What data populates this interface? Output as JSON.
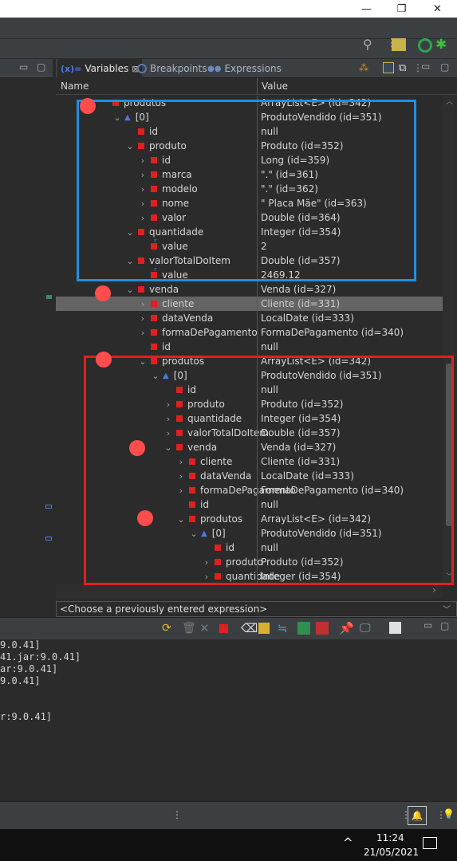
{
  "window": {
    "minimize": "—",
    "restore": "❐",
    "close": "✕"
  },
  "tabs": [
    {
      "label": "Variables",
      "icon": "variables-icon",
      "close": "⊠"
    },
    {
      "label": "Breakpoints",
      "icon": "breakpoints-icon"
    },
    {
      "label": "Expressions",
      "icon": "expressions-icon"
    }
  ],
  "columns": {
    "name": "Name",
    "value": "Value"
  },
  "rows": [
    {
      "indent": 0,
      "twisty": "",
      "icon": "arraylist",
      "name": "produtos",
      "value": "ArrayList<E>  (id=342)"
    },
    {
      "indent": 1,
      "twisty": "v",
      "icon": "element",
      "name": "[0]",
      "value": "ProdutoVendido  (id=351)"
    },
    {
      "indent": 2,
      "twisty": "",
      "icon": "field",
      "name": "id",
      "value": "null"
    },
    {
      "indent": 2,
      "twisty": "v",
      "icon": "field",
      "name": "produto",
      "value": "Produto  (id=352)"
    },
    {
      "indent": 3,
      "twisty": ">",
      "icon": "field",
      "name": "id",
      "value": "Long  (id=359)"
    },
    {
      "indent": 3,
      "twisty": ">",
      "icon": "field",
      "name": "marca",
      "value": "\".\" (id=361)"
    },
    {
      "indent": 3,
      "twisty": ">",
      "icon": "field",
      "name": "modelo",
      "value": "\".\" (id=362)"
    },
    {
      "indent": 3,
      "twisty": ">",
      "icon": "field",
      "name": "nome",
      "value": "\" Placa Mãe\" (id=363)"
    },
    {
      "indent": 3,
      "twisty": ">",
      "icon": "field",
      "name": "valor",
      "value": "Double  (id=364)"
    },
    {
      "indent": 2,
      "twisty": "v",
      "icon": "field",
      "name": "quantidade",
      "value": "Integer  (id=354)"
    },
    {
      "indent": 3,
      "twisty": "",
      "icon": "final",
      "name": "value",
      "value": "2"
    },
    {
      "indent": 2,
      "twisty": "v",
      "icon": "field",
      "name": "valorTotalDoItem",
      "value": "Double  (id=357)"
    },
    {
      "indent": 3,
      "twisty": "",
      "icon": "final",
      "name": "value",
      "value": "2469.12"
    },
    {
      "indent": 2,
      "twisty": "v",
      "icon": "field",
      "name": "venda",
      "value": "Venda  (id=327)"
    },
    {
      "indent": 3,
      "twisty": ">",
      "icon": "field",
      "name": "cliente",
      "value": "Cliente  (id=331)",
      "selected": true
    },
    {
      "indent": 3,
      "twisty": ">",
      "icon": "field",
      "name": "dataVenda",
      "value": "LocalDate  (id=333)"
    },
    {
      "indent": 3,
      "twisty": ">",
      "icon": "field",
      "name": "formaDePagamento",
      "value": "FormaDePagamento  (id=340)"
    },
    {
      "indent": 3,
      "twisty": "",
      "icon": "field",
      "name": "id",
      "value": "null"
    },
    {
      "indent": 3,
      "twisty": "v",
      "icon": "arraylist",
      "name": "produtos",
      "value": "ArrayList<E>  (id=342)"
    },
    {
      "indent": 4,
      "twisty": "v",
      "icon": "element",
      "name": "[0]",
      "value": "ProdutoVendido  (id=351)"
    },
    {
      "indent": 5,
      "twisty": "",
      "icon": "field",
      "name": "id",
      "value": "null"
    },
    {
      "indent": 5,
      "twisty": ">",
      "icon": "field",
      "name": "produto",
      "value": "Produto  (id=352)"
    },
    {
      "indent": 5,
      "twisty": ">",
      "icon": "field",
      "name": "quantidade",
      "value": "Integer  (id=354)"
    },
    {
      "indent": 5,
      "twisty": ">",
      "icon": "field",
      "name": "valorTotalDoItem",
      "value": "Double  (id=357)"
    },
    {
      "indent": 5,
      "twisty": "v",
      "icon": "field",
      "name": "venda",
      "value": "Venda  (id=327)"
    },
    {
      "indent": 6,
      "twisty": ">",
      "icon": "field",
      "name": "cliente",
      "value": "Cliente  (id=331)"
    },
    {
      "indent": 6,
      "twisty": ">",
      "icon": "field",
      "name": "dataVenda",
      "value": "LocalDate  (id=333)"
    },
    {
      "indent": 6,
      "twisty": ">",
      "icon": "field",
      "name": "formaDePagamento",
      "value": "FormaDePagamento  (id=340)"
    },
    {
      "indent": 6,
      "twisty": "",
      "icon": "field",
      "name": "id",
      "value": "null"
    },
    {
      "indent": 6,
      "twisty": "v",
      "icon": "arraylist",
      "name": "produtos",
      "value": "ArrayList<E>  (id=342)"
    },
    {
      "indent": 7,
      "twisty": "v",
      "icon": "element",
      "name": "[0]",
      "value": "ProdutoVendido  (id=351)"
    },
    {
      "indent": 8,
      "twisty": "",
      "icon": "field",
      "name": "id",
      "value": "null"
    },
    {
      "indent": 8,
      "twisty": ">",
      "icon": "field",
      "name": "produto",
      "value": "Produto  (id=352)"
    },
    {
      "indent": 8,
      "twisty": ">",
      "icon": "field",
      "name": "quantidade",
      "value": "Integer  (id=354)"
    }
  ],
  "expression": {
    "placeholder": "<Choose a previously entered expression>"
  },
  "console_lines": [
    "9.0.41]",
    "41.jar:9.0.41]",
    "ar:9.0.41]",
    "9.0.41]",
    "",
    "",
    "r:9.0.41]"
  ],
  "taskbar": {
    "time": "11:24",
    "date": "21/05/2021",
    "chevron": "^"
  },
  "colors": {
    "highlight_blue": "#1f8fe0",
    "highlight_red": "#e02020",
    "field_icon": "#e02020",
    "dot": "#ff4d4d"
  }
}
